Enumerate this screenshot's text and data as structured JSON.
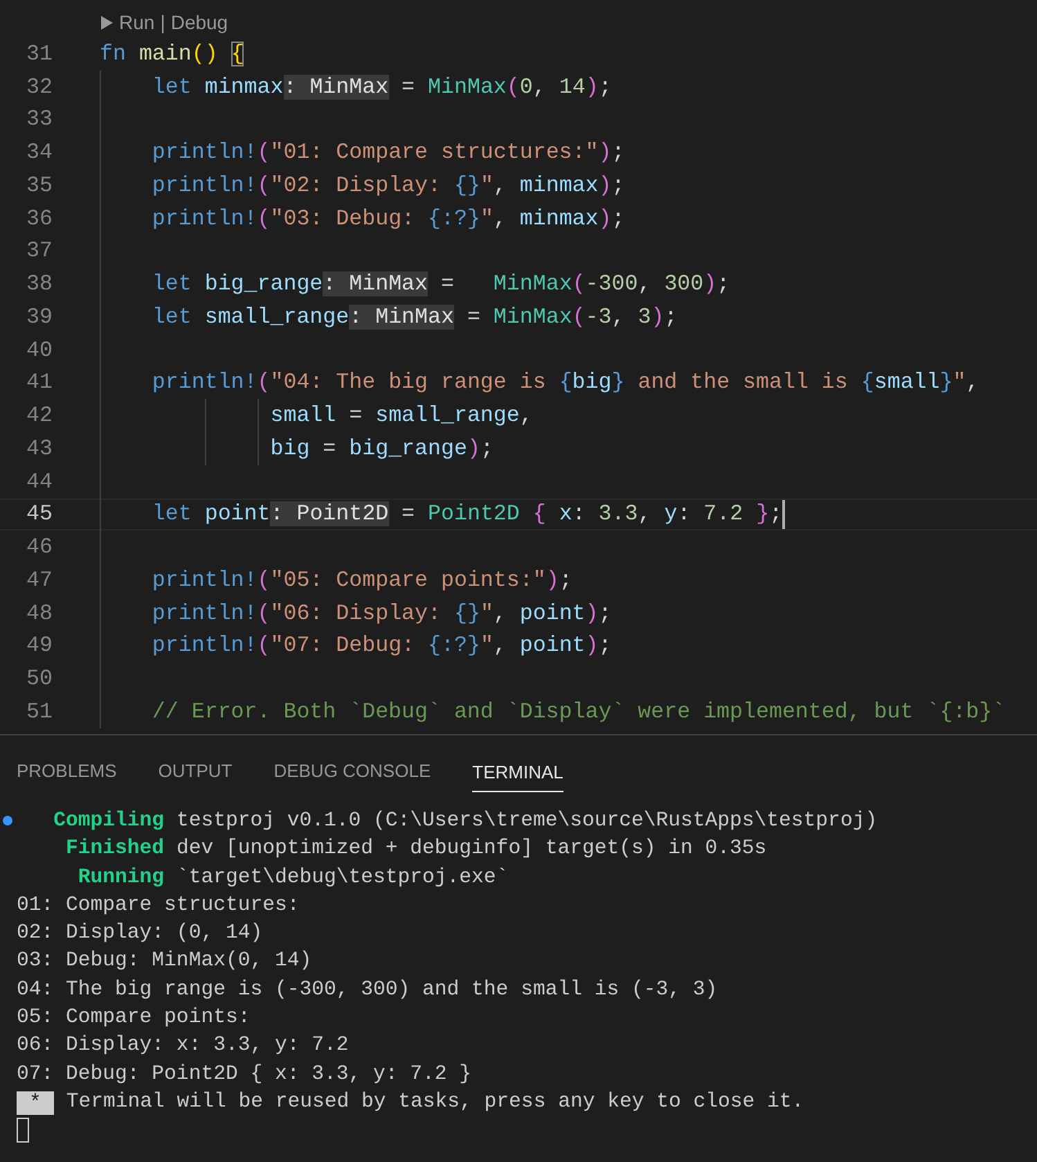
{
  "editor": {
    "codelens": {
      "links": [
        "Run",
        "Debug"
      ],
      "separator": "|"
    },
    "lines": [
      {
        "number": "31",
        "current": false,
        "tokens": [
          {
            "text": "fn ",
            "kind": "keyword"
          },
          {
            "text": "main",
            "kind": "function"
          },
          {
            "text": "() ",
            "kind": "bracket1"
          },
          {
            "text": "{",
            "kind": "bracket-match"
          }
        ]
      },
      {
        "number": "32",
        "current": false,
        "tokens": [
          {
            "text": "    let ",
            "kind": "keyword"
          },
          {
            "text": "minmax",
            "kind": "variable"
          },
          {
            "text": ": MinMax",
            "kind": "hint"
          },
          {
            "text": " = ",
            "kind": "plain"
          },
          {
            "text": "MinMax",
            "kind": "type"
          },
          {
            "text": "(",
            "kind": "bracket2"
          },
          {
            "text": "0",
            "kind": "number"
          },
          {
            "text": ", ",
            "kind": "plain"
          },
          {
            "text": "14",
            "kind": "number"
          },
          {
            "text": ")",
            "kind": "bracket2"
          },
          {
            "text": ";",
            "kind": "plain"
          }
        ]
      },
      {
        "number": "33",
        "current": false
      },
      {
        "number": "34",
        "current": false,
        "tokens": [
          {
            "text": "    println!",
            "kind": "macro"
          },
          {
            "text": "(",
            "kind": "bracket2"
          },
          {
            "text": "\"01: Compare structures:\"",
            "kind": "string"
          },
          {
            "text": ")",
            "kind": "bracket2"
          },
          {
            "text": ";",
            "kind": "plain"
          }
        ]
      },
      {
        "number": "35",
        "current": false,
        "tokens": [
          {
            "text": "    println!",
            "kind": "macro"
          },
          {
            "text": "(",
            "kind": "bracket2"
          },
          {
            "text": "\"02: Display: ",
            "kind": "string"
          },
          {
            "text": "{}",
            "kind": "format"
          },
          {
            "text": "\"",
            "kind": "string"
          },
          {
            "text": ", ",
            "kind": "plain"
          },
          {
            "text": "minmax",
            "kind": "variable"
          },
          {
            "text": ")",
            "kind": "bracket2"
          },
          {
            "text": ";",
            "kind": "plain"
          }
        ]
      },
      {
        "number": "36",
        "current": false,
        "tokens": [
          {
            "text": "    println!",
            "kind": "macro"
          },
          {
            "text": "(",
            "kind": "bracket2"
          },
          {
            "text": "\"03: Debug: ",
            "kind": "string"
          },
          {
            "text": "{:?}",
            "kind": "format"
          },
          {
            "text": "\"",
            "kind": "string"
          },
          {
            "text": ", ",
            "kind": "plain"
          },
          {
            "text": "minmax",
            "kind": "variable"
          },
          {
            "text": ")",
            "kind": "bracket2"
          },
          {
            "text": ";",
            "kind": "plain"
          }
        ]
      },
      {
        "number": "37",
        "current": false
      },
      {
        "number": "38",
        "current": false,
        "tokens": [
          {
            "text": "    let ",
            "kind": "keyword"
          },
          {
            "text": "big_range",
            "kind": "variable"
          },
          {
            "text": ": MinMax",
            "kind": "hint"
          },
          {
            "text": " =   ",
            "kind": "plain"
          },
          {
            "text": "MinMax",
            "kind": "type"
          },
          {
            "text": "(",
            "kind": "bracket2"
          },
          {
            "text": "-300",
            "kind": "number"
          },
          {
            "text": ", ",
            "kind": "plain"
          },
          {
            "text": "300",
            "kind": "number"
          },
          {
            "text": ")",
            "kind": "bracket2"
          },
          {
            "text": ";",
            "kind": "plain"
          }
        ]
      },
      {
        "number": "39",
        "current": false,
        "tokens": [
          {
            "text": "    let ",
            "kind": "keyword"
          },
          {
            "text": "small_range",
            "kind": "variable"
          },
          {
            "text": ": MinMax",
            "kind": "hint"
          },
          {
            "text": " = ",
            "kind": "plain"
          },
          {
            "text": "MinMax",
            "kind": "type"
          },
          {
            "text": "(",
            "kind": "bracket2"
          },
          {
            "text": "-3",
            "kind": "number"
          },
          {
            "text": ", ",
            "kind": "plain"
          },
          {
            "text": "3",
            "kind": "number"
          },
          {
            "text": ")",
            "kind": "bracket2"
          },
          {
            "text": ";",
            "kind": "plain"
          }
        ]
      },
      {
        "number": "40",
        "current": false
      },
      {
        "number": "41",
        "current": false,
        "tokens": [
          {
            "text": "    println!",
            "kind": "macro"
          },
          {
            "text": "(",
            "kind": "bracket2"
          },
          {
            "text": "\"04: The big range is ",
            "kind": "string"
          },
          {
            "text": "{",
            "kind": "format"
          },
          {
            "text": "big",
            "kind": "variable"
          },
          {
            "text": "}",
            "kind": "format"
          },
          {
            "text": " and the small is ",
            "kind": "string"
          },
          {
            "text": "{",
            "kind": "format"
          },
          {
            "text": "small",
            "kind": "variable"
          },
          {
            "text": "}",
            "kind": "format"
          },
          {
            "text": "\"",
            "kind": "string"
          },
          {
            "text": ",",
            "kind": "plain"
          }
        ]
      },
      {
        "number": "42",
        "current": false,
        "tokens": [
          {
            "text": "             small",
            "kind": "variable"
          },
          {
            "text": " = ",
            "kind": "plain"
          },
          {
            "text": "small_range",
            "kind": "variable"
          },
          {
            "text": ",",
            "kind": "plain"
          }
        ]
      },
      {
        "number": "43",
        "current": false,
        "tokens": [
          {
            "text": "             big",
            "kind": "variable"
          },
          {
            "text": " = ",
            "kind": "plain"
          },
          {
            "text": "big_range",
            "kind": "variable"
          },
          {
            "text": ")",
            "kind": "bracket2"
          },
          {
            "text": ";",
            "kind": "plain"
          }
        ]
      },
      {
        "number": "44",
        "current": false
      },
      {
        "number": "45",
        "current": true,
        "tokens": [
          {
            "text": "    let ",
            "kind": "keyword"
          },
          {
            "text": "point",
            "kind": "variable"
          },
          {
            "text": ": Point2D",
            "kind": "hint"
          },
          {
            "text": " = ",
            "kind": "plain"
          },
          {
            "text": "Point2D ",
            "kind": "type"
          },
          {
            "text": "{ ",
            "kind": "bracket2"
          },
          {
            "text": "x",
            "kind": "variable"
          },
          {
            "text": ": ",
            "kind": "plain"
          },
          {
            "text": "3.3",
            "kind": "number"
          },
          {
            "text": ", ",
            "kind": "plain"
          },
          {
            "text": "y",
            "kind": "variable"
          },
          {
            "text": ": ",
            "kind": "plain"
          },
          {
            "text": "7.2 ",
            "kind": "number"
          },
          {
            "text": "}",
            "kind": "bracket2"
          },
          {
            "text": ";",
            "kind": "plain"
          }
        ]
      },
      {
        "number": "46",
        "current": false
      },
      {
        "number": "47",
        "current": false,
        "tokens": [
          {
            "text": "    println!",
            "kind": "macro"
          },
          {
            "text": "(",
            "kind": "bracket2"
          },
          {
            "text": "\"05: Compare points:\"",
            "kind": "string"
          },
          {
            "text": ")",
            "kind": "bracket2"
          },
          {
            "text": ";",
            "kind": "plain"
          }
        ]
      },
      {
        "number": "48",
        "current": false,
        "tokens": [
          {
            "text": "    println!",
            "kind": "macro"
          },
          {
            "text": "(",
            "kind": "bracket2"
          },
          {
            "text": "\"06: Display: ",
            "kind": "string"
          },
          {
            "text": "{}",
            "kind": "format"
          },
          {
            "text": "\"",
            "kind": "string"
          },
          {
            "text": ", ",
            "kind": "plain"
          },
          {
            "text": "point",
            "kind": "variable"
          },
          {
            "text": ")",
            "kind": "bracket2"
          },
          {
            "text": ";",
            "kind": "plain"
          }
        ]
      },
      {
        "number": "49",
        "current": false,
        "tokens": [
          {
            "text": "    println!",
            "kind": "macro"
          },
          {
            "text": "(",
            "kind": "bracket2"
          },
          {
            "text": "\"07: Debug: ",
            "kind": "string"
          },
          {
            "text": "{:?}",
            "kind": "format"
          },
          {
            "text": "\"",
            "kind": "string"
          },
          {
            "text": ", ",
            "kind": "plain"
          },
          {
            "text": "point",
            "kind": "variable"
          },
          {
            "text": ")",
            "kind": "bracket2"
          },
          {
            "text": ";",
            "kind": "plain"
          }
        ]
      },
      {
        "number": "50",
        "current": false
      },
      {
        "number": "51",
        "current": false,
        "tokens": [
          {
            "text": "    // Error. Both `Debug` and `Display` were implemented, but `{:b}`",
            "kind": "comment"
          }
        ]
      }
    ]
  },
  "panel": {
    "tabs": [
      {
        "label": "PROBLEMS",
        "selected": false
      },
      {
        "label": "OUTPUT",
        "selected": false
      },
      {
        "label": "DEBUG CONSOLE",
        "selected": false
      },
      {
        "label": "TERMINAL",
        "selected": true
      }
    ],
    "terminal": {
      "cursor": true,
      "lines": [
        {
          "kind": "output",
          "decorated": true,
          "parts": [
            {
              "text": "   Compiling",
              "kind": "status"
            },
            {
              "text": " testproj v0.1.0 (C:\\Users\\treme\\source\\RustApps\\testproj)",
              "kind": "plain"
            }
          ]
        },
        {
          "kind": "output",
          "decorated": false,
          "parts": [
            {
              "text": "    Finished",
              "kind": "status"
            },
            {
              "text": " dev [unoptimized + debuginfo] target(s) in 0.35s",
              "kind": "plain"
            }
          ]
        },
        {
          "kind": "output",
          "decorated": false,
          "parts": [
            {
              "text": "     Running",
              "kind": "status"
            },
            {
              "text": " `target\\debug\\testproj.exe`",
              "kind": "plain"
            }
          ]
        },
        {
          "kind": "output",
          "decorated": false,
          "parts": [
            {
              "text": "01: Compare structures:",
              "kind": "plain"
            }
          ]
        },
        {
          "kind": "output",
          "decorated": false,
          "parts": [
            {
              "text": "02: Display: (0, 14)",
              "kind": "plain"
            }
          ]
        },
        {
          "kind": "output",
          "decorated": false,
          "parts": [
            {
              "text": "03: Debug: MinMax(0, 14)",
              "kind": "plain"
            }
          ]
        },
        {
          "kind": "output",
          "decorated": false,
          "parts": [
            {
              "text": "04: The big range is (-300, 300) and the small is (-3, 3)",
              "kind": "plain"
            }
          ]
        },
        {
          "kind": "output",
          "decorated": false,
          "parts": [
            {
              "text": "05: Compare points:",
              "kind": "plain"
            }
          ]
        },
        {
          "kind": "output",
          "decorated": false,
          "parts": [
            {
              "text": "06: Display: x: 3.3, y: 7.2",
              "kind": "plain"
            }
          ]
        },
        {
          "kind": "output",
          "decorated": false,
          "parts": [
            {
              "text": "07: Debug: Point2D { x: 3.3, y: 7.2 }",
              "kind": "plain"
            }
          ]
        },
        {
          "kind": "task",
          "decorated": false,
          "badge": "*",
          "text": "Terminal will be reused by tasks, press any key to close it."
        }
      ]
    }
  }
}
